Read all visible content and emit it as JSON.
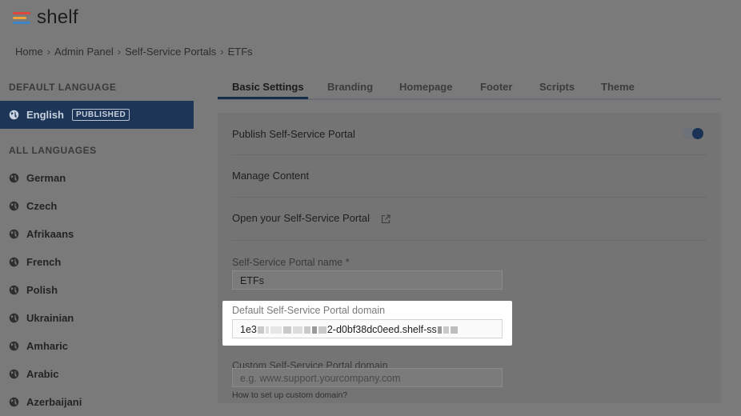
{
  "app": {
    "logo_text": "shelf"
  },
  "breadcrumb": [
    "Home",
    "Admin Panel",
    "Self-Service Portals",
    "ETFs"
  ],
  "breadcrumb_sep": "›",
  "sidebar": {
    "default_heading": "DEFAULT LANGUAGE",
    "default_lang": {
      "name": "English",
      "badge": "PUBLISHED"
    },
    "all_heading": "ALL LANGUAGES",
    "languages": [
      "German",
      "Czech",
      "Afrikaans",
      "French",
      "Polish",
      "Ukrainian",
      "Amharic",
      "Arabic",
      "Azerbaijani"
    ]
  },
  "tabs": [
    "Basic Settings",
    "Branding",
    "Homepage",
    "Footer",
    "Scripts",
    "Theme"
  ],
  "settings": {
    "publish_label": "Publish Self-Service Portal",
    "publish_on": true,
    "manage_content": "Manage Content",
    "open_portal": "Open your Self-Service Portal",
    "name_label": "Self-Service Portal name *",
    "name_value": "ETFs",
    "domain_label": "Default Self-Service Portal domain",
    "domain_prefix": "1e3",
    "domain_middle": "2-d0bf38dc0eed.shelf-ss",
    "custom_label": "Custom Self-Service Portal domain",
    "custom_placeholder": "e.g. www.support.yourcompany.com",
    "custom_help": "How to set up custom domain?"
  },
  "colors": {
    "accent": "#1d3557",
    "logo_red": "#e0473c",
    "logo_orange": "#f3a239",
    "logo_blue": "#3c84c6"
  }
}
